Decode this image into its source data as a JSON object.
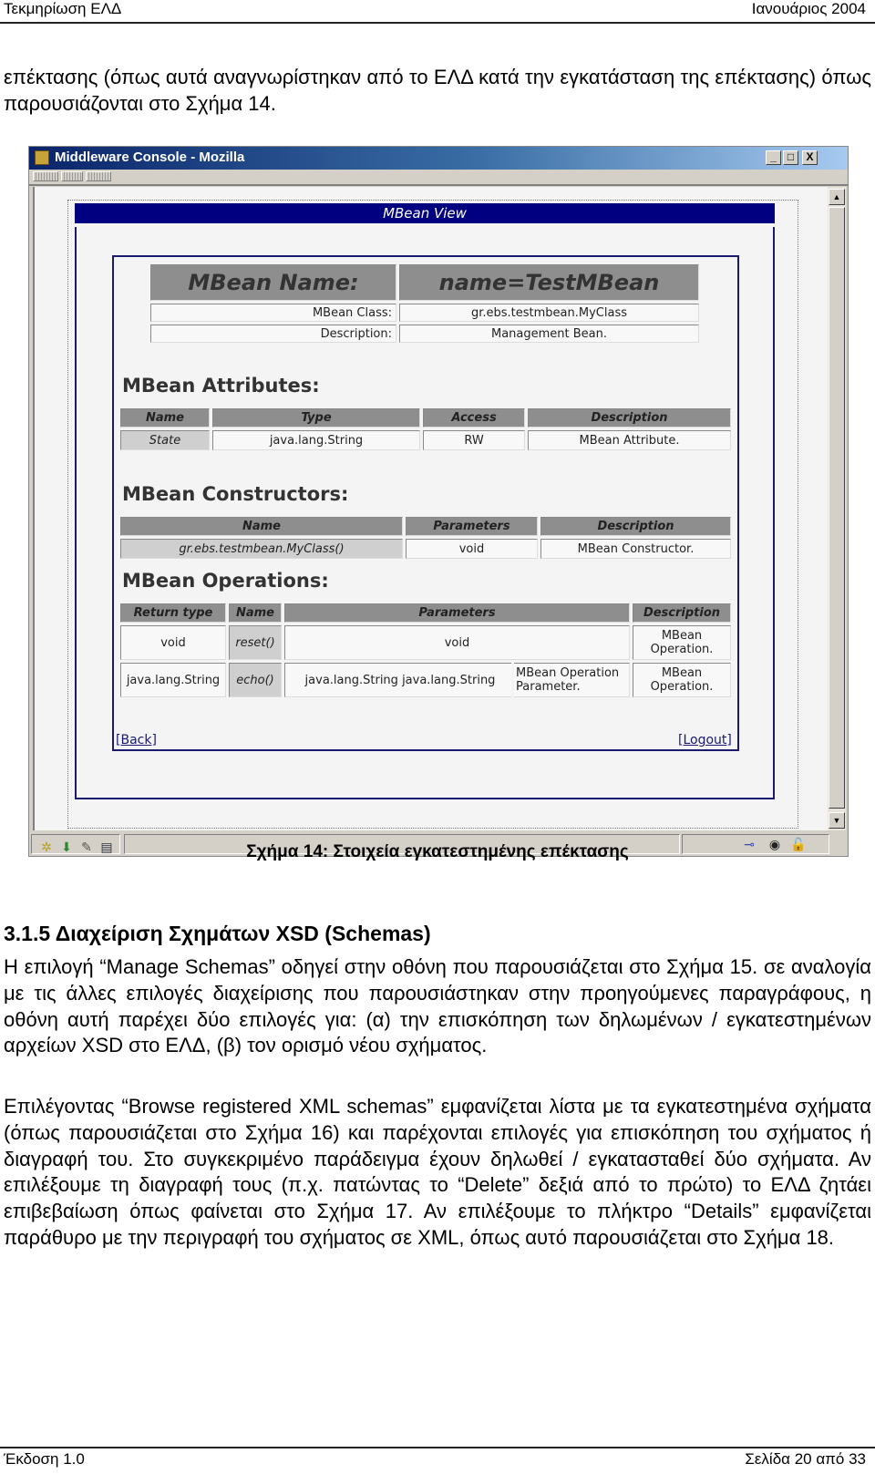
{
  "header": {
    "left": "Τεκμηρίωση ΕΛΔ",
    "right": "Ιανουάριος 2004"
  },
  "intro_paragraph": "επέκτασης (όπως αυτά αναγνωρίστηκαν από το ΕΛΔ κατά την εγκατάσταση της επέκτασης) όπως παρουσιάζονται στο Σχήμα 14.",
  "figure": {
    "window_title": "Middleware Console - Mozilla",
    "window_buttons": {
      "minimize": "_",
      "maximize": "□",
      "close": "X"
    },
    "banner": "MBean View",
    "mbean": {
      "name_label": "MBean Name:",
      "name_value": "name=TestMBean",
      "rows": [
        {
          "label": "MBean Class:",
          "value": "gr.ebs.testmbean.MyClass"
        },
        {
          "label": "Description:",
          "value": "Management Bean."
        }
      ]
    },
    "attributes": {
      "heading": "MBean Attributes:",
      "columns": [
        "Name",
        "Type",
        "Access",
        "Description"
      ],
      "rows": [
        [
          "State",
          "java.lang.String",
          "RW",
          "MBean Attribute."
        ]
      ]
    },
    "constructors": {
      "heading": "MBean Constructors:",
      "columns": [
        "Name",
        "Parameters",
        "Description"
      ],
      "rows": [
        [
          "gr.ebs.testmbean.MyClass()",
          "void",
          "MBean Constructor."
        ]
      ]
    },
    "operations": {
      "heading": "MBean Operations:",
      "columns": [
        "Return type",
        "Name",
        "Parameters",
        "Description"
      ],
      "rows": [
        {
          "return_type": "void",
          "name": "reset()",
          "param_type": "void",
          "param_name": "",
          "param_desc": "",
          "description": "MBean Operation."
        },
        {
          "return_type": "java.lang.String",
          "name": "echo()",
          "param_type": "java.lang.String",
          "param_name": "java.lang.String",
          "param_desc": "MBean Operation Parameter.",
          "description": "MBean Operation."
        }
      ]
    },
    "links": {
      "back": "Back",
      "logout": "Logout",
      "open": "[",
      "close": "]"
    },
    "icons": {
      "status_left": [
        "navigator-icon",
        "download-icon",
        "composer-icon",
        "address-book-icon"
      ],
      "status_right": [
        "connection-icon",
        "privacy-icon",
        "security-lock-icon"
      ]
    },
    "caption": "Σχήμα 14: Στοιχεία εγκατεστημένης επέκτασης"
  },
  "section": {
    "heading": "3.1.5  Διαχείριση Σχημάτων XSD (Schemas)",
    "paragraph1": "Η επιλογή “Manage Schemas” οδηγεί στην οθόνη που παρουσιάζεται στο Σχήμα 15. σε αναλογία με τις άλλες επιλογές διαχείρισης που παρουσιάστηκαν στην προηγούμενες παραγράφους, η οθόνη αυτή παρέχει δύο επιλογές για: (α) την επισκόπηση των δηλωμένων / εγκατεστημένων αρχείων XSD στο ΕΛΔ, (β) τον ορισμό νέου σχήματος.",
    "paragraph2": "Επιλέγοντας “Browse registered XML schemas” εμφανίζεται λίστα με τα εγκατεστημένα σχήματα (όπως παρουσιάζεται στο Σχήμα 16) και παρέχονται επιλογές για επισκόπηση του σχήματος ή διαγραφή του. Στο συγκεκριμένο παράδειγμα έχουν δηλωθεί / εγκατασταθεί δύο σχήματα. Αν επιλέξουμε τη διαγραφή τους (π.χ. πατώντας το “Delete” δεξιά από το πρώτο) το ΕΛΔ ζητάει επιβεβαίωση όπως φαίνεται στο Σχήμα 17. Αν επιλέξουμε το πλήκτρο “Details” εμφανίζεται παράθυρο με την περιγραφή του σχήματος σε XML, όπως αυτό παρουσιάζεται στο Σχήμα 18."
  },
  "footer": {
    "left": "Έκδοση 1.0",
    "right": "Σελίδα 20 από 33"
  }
}
